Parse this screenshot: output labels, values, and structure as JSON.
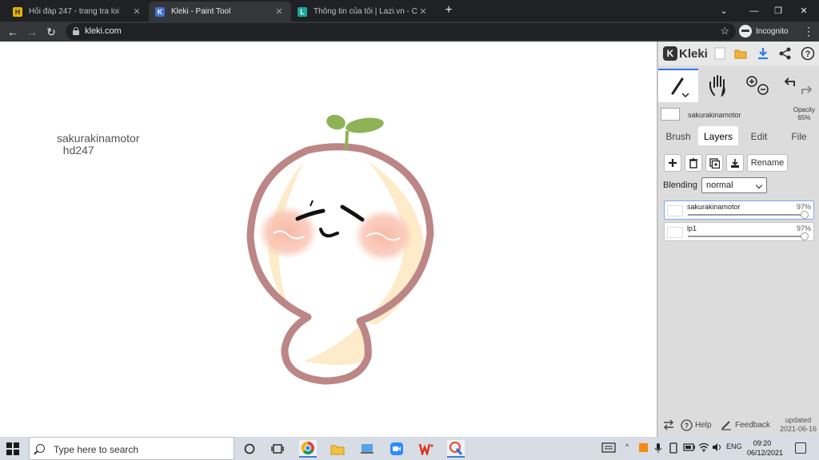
{
  "browser": {
    "tabs": [
      {
        "title": "Hỏi đáp 247 - trang tra loi",
        "favicon_letter": "H",
        "favicon_color": "#2f7ddc",
        "active": false
      },
      {
        "title": "Kleki - Paint Tool",
        "favicon_letter": "K",
        "favicon_color": "#3d6fd8",
        "active": true
      },
      {
        "title": "Thông tin của tôi | Lazi.vn - Cộng",
        "favicon_letter": "L",
        "favicon_color": "#1aa59a",
        "active": false
      }
    ],
    "new_tab_label": "+",
    "url": "kleki.com",
    "incognito_label": "Incognito"
  },
  "canvas": {
    "text_lines": "sakurakinamotor\n  hd247"
  },
  "kleki": {
    "logo_text": "Kleki",
    "brush_name": "sakurakinamotor",
    "opacity_label": "Opacity",
    "opacity_value": "65%",
    "tabs": [
      "Brush",
      "Layers",
      "Edit",
      "File"
    ],
    "active_tab": "Layers",
    "rename_label": "Rename",
    "blending_label": "Blending",
    "blending_value": "normal",
    "layers": [
      {
        "name": "sakurakinamotor",
        "opacity": 0.97,
        "opacity_label": "97%",
        "selected": true
      },
      {
        "name": "lp1",
        "opacity": 0.97,
        "opacity_label": "97%",
        "selected": false
      }
    ],
    "help_label": "Help",
    "feedback_label": "Feedback",
    "updated_label": "updated",
    "updated_date": "2021-06-16"
  },
  "taskbar": {
    "search_placeholder": "Type here to search",
    "language": "ENG",
    "time": "09:20",
    "date": "06/12/2021"
  }
}
